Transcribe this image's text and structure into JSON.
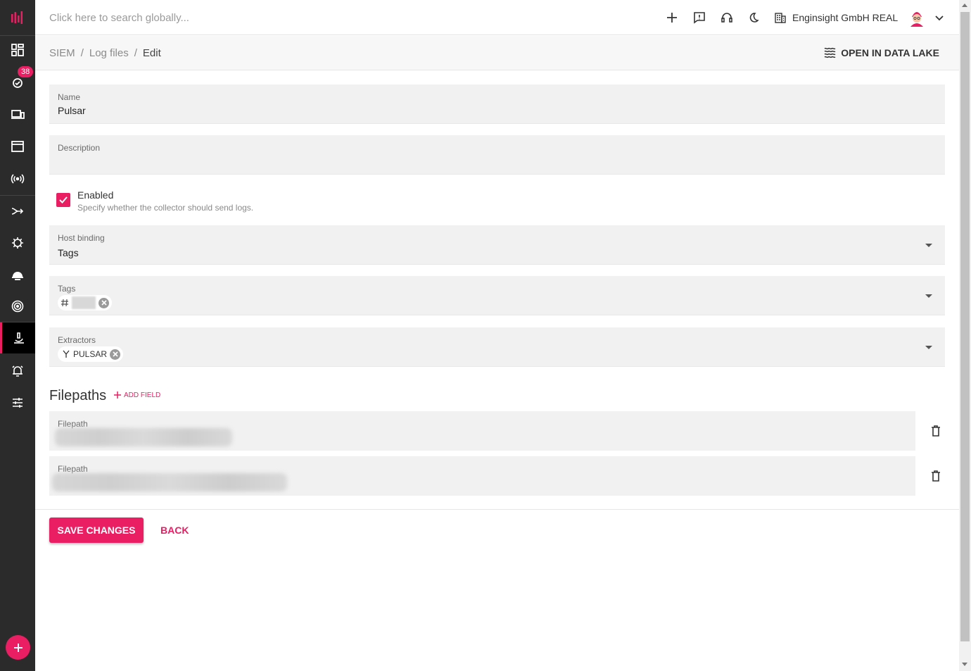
{
  "colors": {
    "accent": "#e91e63",
    "sidebar": "#2b2b2b"
  },
  "sidebar": {
    "logo": "logo-bars-icon",
    "badge_count": "38",
    "items": [
      {
        "icon": "dashboard-icon"
      },
      {
        "icon": "issues-icon"
      },
      {
        "icon": "devices-icon"
      },
      {
        "icon": "window-icon"
      },
      {
        "icon": "broadcast-icon"
      },
      {
        "icon": "flow-icon"
      },
      {
        "icon": "virus-icon"
      },
      {
        "icon": "helmet-icon"
      },
      {
        "icon": "radar-icon"
      },
      {
        "icon": "microscope-icon"
      },
      {
        "icon": "alarm-icon"
      },
      {
        "icon": "sliders-icon"
      }
    ],
    "fab_icon": "plus-icon"
  },
  "topbar": {
    "search_placeholder": "Click here to search globally...",
    "company": "Enginsight GmbH REAL"
  },
  "breadcrumb": {
    "items": [
      "SIEM",
      "Log files",
      "Edit"
    ],
    "separator": "/"
  },
  "header_action": "OPEN IN DATA LAKE",
  "form": {
    "name_label": "Name",
    "name_value": "Pulsar",
    "description_label": "Description",
    "description_value": "",
    "enabled_label": "Enabled",
    "enabled_help": "Specify whether the collector should send logs.",
    "enabled": true,
    "host_binding_label": "Host binding",
    "host_binding_value": "Tags",
    "tags_label": "Tags",
    "extractors_label": "Extractors",
    "extractor_chip": "PULSAR"
  },
  "filepaths": {
    "title": "Filepaths",
    "add_label": "ADD FIELD",
    "items": [
      {
        "label": "Filepath"
      },
      {
        "label": "Filepath"
      }
    ]
  },
  "actions": {
    "save_label": "SAVE CHANGES",
    "back_label": "BACK"
  }
}
